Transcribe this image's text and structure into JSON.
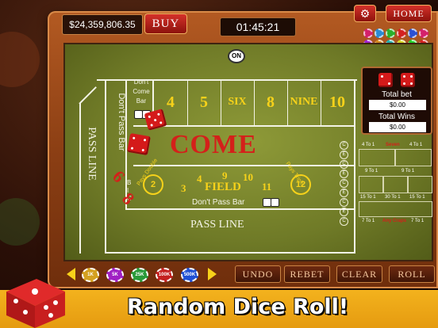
{
  "header": {
    "balance": "$24,359,806.35",
    "buy_label": "BUY",
    "timer": "01:45:21",
    "home_label": "HOME"
  },
  "table": {
    "puck_label": "ON",
    "dont_come_bar": "Don't Come Bar",
    "place_numbers": [
      "4",
      "5",
      "SIX",
      "8",
      "NINE",
      "10"
    ],
    "dont_pass_bar_vertical": "Don't Pass Bar",
    "pass_line_vertical": "PASS LINE",
    "big_label": "B I G",
    "big_six": "6",
    "big_eight": "8",
    "come_label": "COME",
    "pays_double": "Pays Double",
    "double_number": "2",
    "field_numbers": [
      "3",
      "4",
      "9",
      "10",
      "11"
    ],
    "field_label": "FIELD",
    "pays_triple": "Pays Triple",
    "triple_number": "12",
    "dont_pass_bar": "Don't Pass Bar",
    "pass_line": "PASS LINE"
  },
  "bet_panel": {
    "total_bet_label": "Total bet",
    "total_bet_value": "$0.00",
    "total_wins_label": "Total Wins",
    "total_wins_value": "$0.00"
  },
  "props": {
    "row1_left": "4 To 1",
    "row1_center": "Seven",
    "row1_right": "4 To 1",
    "row2_left": "9 To 1",
    "row2_right": "9 To 1",
    "row3_labels": [
      "15 To 1",
      "30 To 1",
      "15 To 1"
    ],
    "row4_left": "7 To 1",
    "row4_center": "Any Craps",
    "row4_right": "7 To 1",
    "e_labels": [
      "C",
      "E",
      "C",
      "E",
      "C",
      "E",
      "C",
      "E",
      "C"
    ]
  },
  "chips": [
    "1K",
    "5K",
    "25K",
    "100K",
    "500K"
  ],
  "controls": {
    "undo": "UNDO",
    "rebet": "REBET",
    "clear": "CLEAR",
    "roll": "ROLL"
  },
  "banner": {
    "text": "Random Dice Roll!"
  },
  "colors": {
    "felt": "#7a862d",
    "accent_red": "#d4201a",
    "gold": "#f7d21a",
    "banner": "#f0a915",
    "wood": "#9c4a1a"
  }
}
